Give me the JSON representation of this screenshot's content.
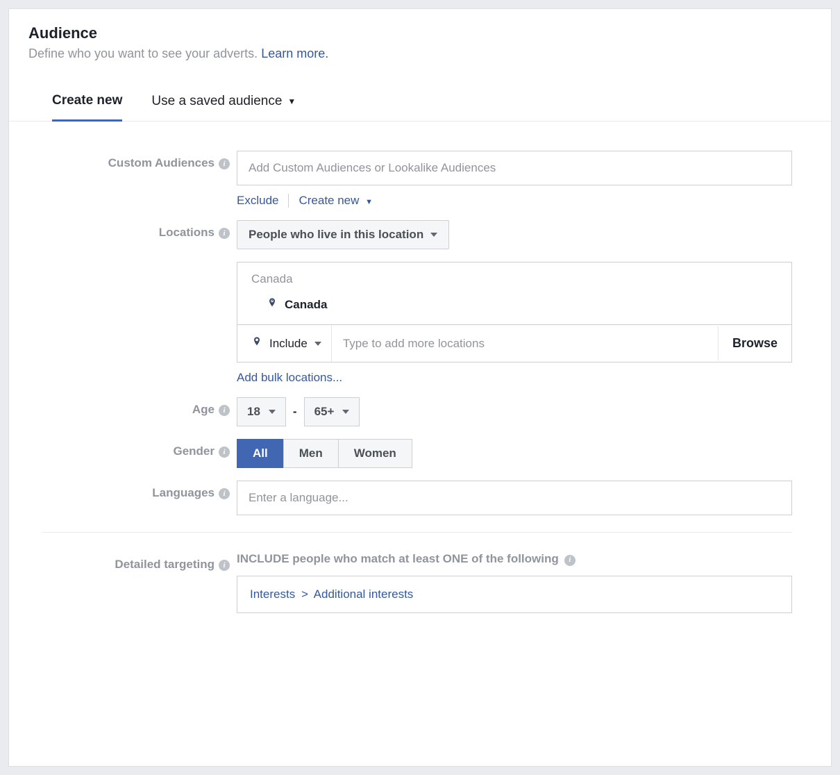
{
  "header": {
    "title": "Audience",
    "subtitle_text": "Define who you want to see your adverts. ",
    "subtitle_link": "Learn more."
  },
  "tabs": {
    "create_new": "Create new",
    "use_saved": "Use a saved audience"
  },
  "custom_audiences": {
    "label": "Custom Audiences",
    "placeholder": "Add Custom Audiences or Lookalike Audiences",
    "exclude": "Exclude",
    "create_new": "Create new"
  },
  "locations": {
    "label": "Locations",
    "mode": "People who live in this location",
    "group_header": "Canada",
    "item": "Canada",
    "include_label": "Include",
    "input_placeholder": "Type to add more locations",
    "browse": "Browse",
    "bulk_link": "Add bulk locations..."
  },
  "age": {
    "label": "Age",
    "min": "18",
    "max": "65+"
  },
  "gender": {
    "label": "Gender",
    "all": "All",
    "men": "Men",
    "women": "Women"
  },
  "languages": {
    "label": "Languages",
    "placeholder": "Enter a language..."
  },
  "detailed": {
    "label": "Detailed targeting",
    "include_heading": "INCLUDE people who match at least ONE of the following",
    "crumb1": "Interests",
    "crumb2": "Additional interests"
  }
}
